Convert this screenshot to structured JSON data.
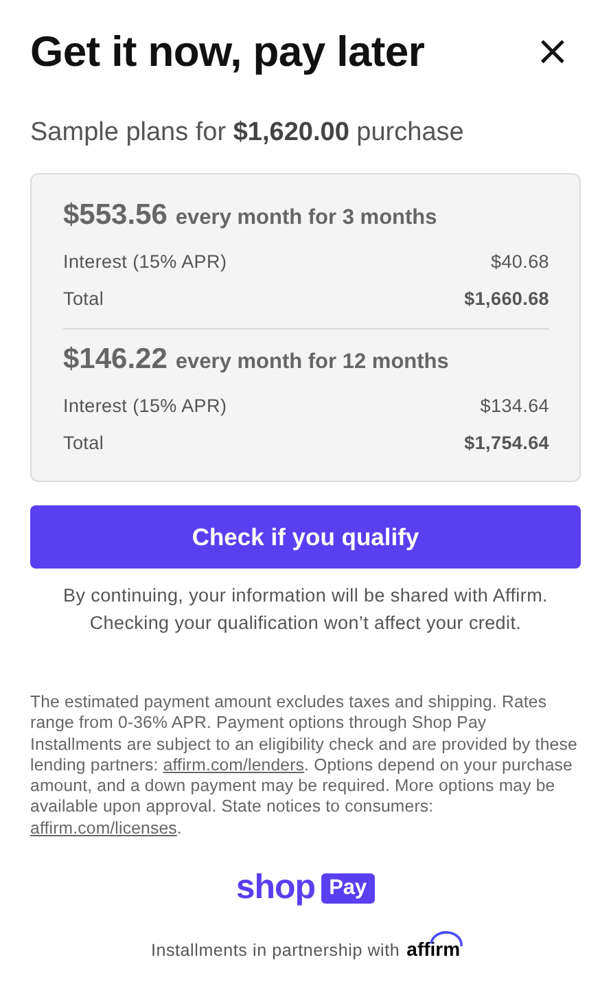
{
  "header": {
    "title": "Get it now, pay later",
    "close": "×"
  },
  "subtitle": {
    "prefix": "Sample plans for ",
    "amount": "$1,620.00",
    "suffix": " purchase"
  },
  "plans": [
    {
      "amount": "$553.56",
      "term": "every month for 3 months",
      "rows": [
        {
          "label": "Interest (15% APR)",
          "value": "$40.68"
        },
        {
          "label": "Total",
          "value": "$1,660.68"
        }
      ]
    },
    {
      "amount": "$146.22",
      "term": "every month for 12 months",
      "rows": [
        {
          "label": "Interest (15% APR)",
          "value": "$134.64"
        },
        {
          "label": "Total",
          "value": "$1,754.64"
        }
      ]
    }
  ],
  "cta": {
    "label": "Check if you qualify"
  },
  "consent": [
    "By continuing, your information will be shared with Affirm.",
    "Checking your qualification won’t affect your credit."
  ],
  "disclaimer": [
    {
      "kind": "text",
      "text": "The estimated payment amount excludes taxes and shipping. Rates range from 0-36% APR. Payment options through Shop Pay Installments are subject to an eligibility check and are provided by these lending partners: "
    },
    {
      "kind": "link",
      "text": "affirm.com/lenders"
    },
    {
      "kind": "text",
      "text": ". Options depend on your purchase amount, and a down payment may be required. More options may be available upon approval. State notices to consumers: "
    },
    {
      "kind": "link",
      "text": "affirm.com/licenses"
    },
    {
      "kind": "text",
      "text": "."
    }
  ],
  "brand": {
    "shop": "shop",
    "pay": "Pay"
  },
  "partnership": {
    "text": "Installments in partnership with",
    "partner": "affirm"
  }
}
